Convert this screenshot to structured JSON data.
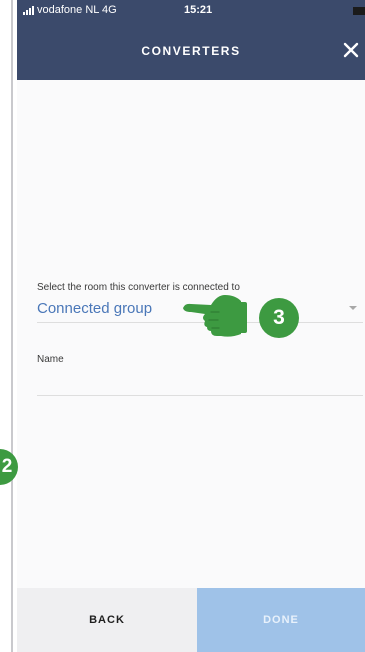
{
  "status_bar": {
    "carrier": "vodafone NL  4G",
    "time": "15:21"
  },
  "header": {
    "title": "CONVERTERS",
    "close_icon": "close-icon"
  },
  "form": {
    "room_label": "Select the room this converter is connected to",
    "room_value": "Connected group",
    "name_label": "Name",
    "name_value": ""
  },
  "footer": {
    "back_label": "BACK",
    "done_label": "DONE"
  },
  "annotations": {
    "step_3": "3",
    "step_2": "2",
    "pointer_icon": "pointing-hand-icon"
  },
  "colors": {
    "header_bg": "#3b4a6b",
    "link_blue": "#4a77b8",
    "done_bg": "#9fc2e8",
    "badge_green": "#3d9a41"
  }
}
